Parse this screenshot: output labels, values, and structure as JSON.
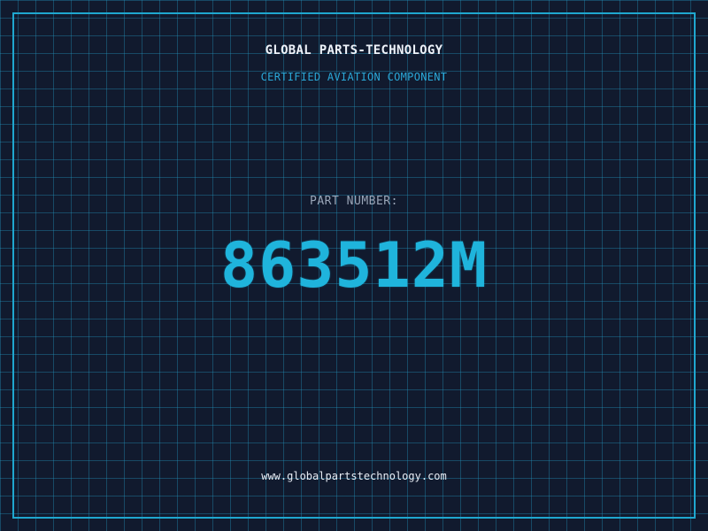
{
  "header": {
    "company": "GLOBAL PARTS-TECHNOLOGY",
    "subtitle": "CERTIFIED AVIATION COMPONENT"
  },
  "main": {
    "part_label": "PART NUMBER:",
    "part_number": "863512M"
  },
  "footer": {
    "website": "www.globalpartstechnology.com"
  },
  "colors": {
    "background": "#111a2e",
    "grid": "#2296be",
    "frame": "#1fa7cf",
    "accent": "#1fb4dc",
    "label": "#9aa6b8",
    "text": "#eef3fa"
  }
}
